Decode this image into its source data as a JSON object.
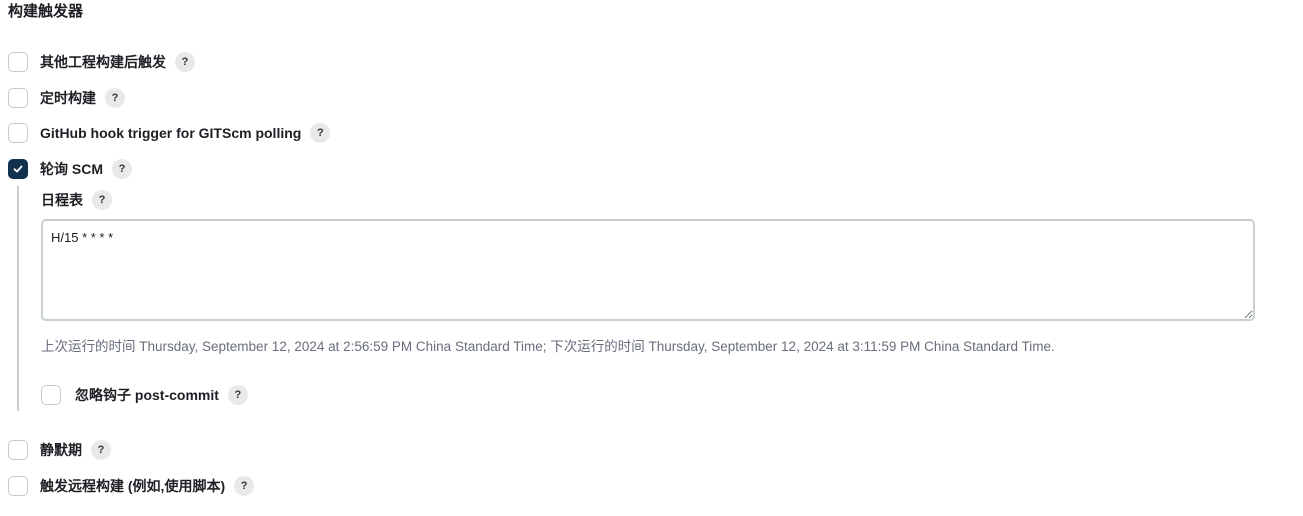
{
  "section_title": "构建触发器",
  "triggers": [
    {
      "label": "其他工程构建后触发",
      "checked": false
    },
    {
      "label": "定时构建",
      "checked": false
    },
    {
      "label": "GitHub hook trigger for GITScm polling",
      "checked": false
    },
    {
      "label": "轮询 SCM",
      "checked": true
    },
    {
      "label": "静默期",
      "checked": false
    },
    {
      "label": "触发远程构建 (例如,使用脚本)",
      "checked": false
    }
  ],
  "poll_scm": {
    "schedule_label": "日程表",
    "schedule_value": "H/15 * * * *",
    "hint": "上次运行的时间 Thursday, September 12, 2024 at 2:56:59 PM China Standard Time; 下次运行的时间 Thursday, September 12, 2024 at 3:11:59 PM China Standard Time.",
    "ignore_post_commit": {
      "label": "忽略钩子 post-commit",
      "checked": false
    }
  },
  "help_label": "?",
  "colors": {
    "checked": "#11324f",
    "border": "#c3cbd1",
    "help_bg": "#e8e9eb"
  }
}
